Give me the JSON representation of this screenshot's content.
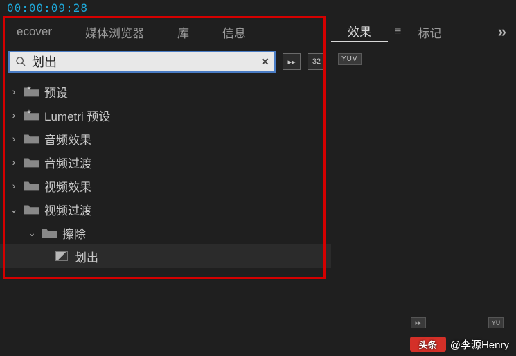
{
  "timecode": "00:00:09:28",
  "leftTabs": {
    "t1": "ecover",
    "t2": "媒体浏览器",
    "t3": "库",
    "t4": "信息"
  },
  "rightTabs": {
    "active": "效果",
    "eq": "≡",
    "second": "标记",
    "overflow": "»"
  },
  "search": {
    "value": "划出"
  },
  "badges": {
    "b1": "▸▸",
    "b2": "32",
    "yuv": "YUV"
  },
  "tree": {
    "presets": "预设",
    "lumetri": "Lumetri 预设",
    "audioFx": "音频效果",
    "audioTr": "音频过渡",
    "videoFx": "视频效果",
    "videoTr": "视频过渡",
    "wipe": "擦除",
    "wipeOut": "划出"
  },
  "bottomBadges": {
    "b1": "▸▸",
    "b2": "YU"
  },
  "watermark": {
    "logo": "头条",
    "user": "@李源Henry"
  }
}
